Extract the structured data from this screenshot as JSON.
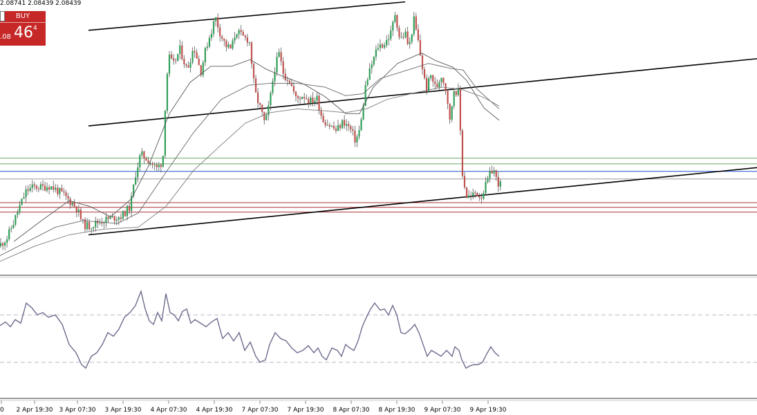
{
  "ohlc_text": "2.08741 2.08439 2.08439",
  "trade_panel": {
    "label": "BUY",
    "price_small": ".08",
    "price_big": "46",
    "price_sup": "4",
    "color": "#c62828"
  },
  "chart_data": [
    {
      "type": "candlestick",
      "x_ticks": [
        "0",
        "2 Apr 19:30",
        "3 Apr 07:30",
        "3 Apr 19:30",
        "4 Apr 07:30",
        "4 Apr 19:30",
        "7 Apr 07:30",
        "7 Apr 19:30",
        "8 Apr 07:30",
        "8 Apr 19:30",
        "9 Apr 07:30",
        "9 Apr 19:30"
      ],
      "y_range": [
        2.0655,
        2.0945
      ],
      "grid": false,
      "price_anchors": [
        [
          0,
          2.0685
        ],
        [
          12,
          2.0694
        ],
        [
          22,
          2.0712
        ],
        [
          30,
          2.0727
        ],
        [
          40,
          2.0744
        ],
        [
          52,
          2.0748
        ],
        [
          62,
          2.0747
        ],
        [
          72,
          2.0749
        ],
        [
          82,
          2.0745
        ],
        [
          92,
          2.074
        ],
        [
          102,
          2.0733
        ],
        [
          112,
          2.0726
        ],
        [
          122,
          2.0708
        ],
        [
          130,
          2.0706
        ],
        [
          145,
          2.0711
        ],
        [
          160,
          2.0714
        ],
        [
          178,
          2.0717
        ],
        [
          190,
          2.0727
        ],
        [
          198,
          2.0763
        ],
        [
          205,
          2.0782
        ],
        [
          215,
          2.0777
        ],
        [
          228,
          2.0767
        ],
        [
          237,
          2.0775
        ],
        [
          240,
          2.0827
        ],
        [
          245,
          2.0886
        ],
        [
          252,
          2.0876
        ],
        [
          262,
          2.0893
        ],
        [
          272,
          2.0871
        ],
        [
          282,
          2.0896
        ],
        [
          292,
          2.0869
        ],
        [
          300,
          2.0896
        ],
        [
          308,
          2.0914
        ],
        [
          313,
          2.0927
        ],
        [
          320,
          2.091
        ],
        [
          328,
          2.0897
        ],
        [
          336,
          2.0893
        ],
        [
          343,
          2.0913
        ],
        [
          352,
          2.0906
        ],
        [
          362,
          2.0903
        ],
        [
          370,
          2.0848
        ],
        [
          378,
          2.0831
        ],
        [
          385,
          2.0813
        ],
        [
          392,
          2.0839
        ],
        [
          398,
          2.087
        ],
        [
          405,
          2.0888
        ],
        [
          412,
          2.0866
        ],
        [
          420,
          2.0861
        ],
        [
          430,
          2.084
        ],
        [
          440,
          2.0845
        ],
        [
          450,
          2.0838
        ],
        [
          460,
          2.0841
        ],
        [
          468,
          2.0819
        ],
        [
          478,
          2.0813
        ],
        [
          488,
          2.0807
        ],
        [
          498,
          2.0817
        ],
        [
          508,
          2.0809
        ],
        [
          516,
          2.0796
        ],
        [
          523,
          2.0811
        ],
        [
          530,
          2.0853
        ],
        [
          538,
          2.0874
        ],
        [
          548,
          2.0896
        ],
        [
          558,
          2.0899
        ],
        [
          567,
          2.091
        ],
        [
          573,
          2.0931
        ],
        [
          580,
          2.0903
        ],
        [
          588,
          2.091
        ],
        [
          593,
          2.0893
        ],
        [
          600,
          2.0925
        ],
        [
          606,
          2.0903
        ],
        [
          611,
          2.088
        ],
        [
          618,
          2.085
        ],
        [
          625,
          2.0866
        ],
        [
          632,
          2.0851
        ],
        [
          640,
          2.0866
        ],
        [
          648,
          2.0847
        ],
        [
          652,
          2.0815
        ],
        [
          658,
          2.0851
        ],
        [
          665,
          2.0847
        ],
        [
          670,
          2.0764
        ],
        [
          676,
          2.0738
        ],
        [
          683,
          2.0737
        ],
        [
          690,
          2.0742
        ],
        [
          697,
          2.0737
        ],
        [
          703,
          2.0747
        ],
        [
          710,
          2.076
        ],
        [
          715,
          2.0768
        ],
        [
          720,
          2.0754
        ],
        [
          725,
          2.075
        ]
      ],
      "moving_averages": [
        {
          "points": [
            [
              20,
              2.069
            ],
            [
              60,
              2.0712
            ],
            [
              100,
              2.0733
            ],
            [
              130,
              2.0727
            ],
            [
              160,
              2.0716
            ],
            [
              190,
              2.0735
            ],
            [
              215,
              2.077
            ],
            [
              245,
              2.0825
            ],
            [
              275,
              2.0858
            ],
            [
              305,
              2.0875
            ],
            [
              335,
              2.0875
            ],
            [
              362,
              2.0882
            ],
            [
              385,
              2.0872
            ],
            [
              410,
              2.0864
            ],
            [
              440,
              2.0856
            ],
            [
              470,
              2.0843
            ],
            [
              500,
              2.0825
            ],
            [
              520,
              2.0825
            ],
            [
              540,
              2.0853
            ],
            [
              575,
              2.0878
            ],
            [
              610,
              2.0889
            ],
            [
              630,
              2.0881
            ],
            [
              655,
              2.0874
            ],
            [
              675,
              2.086
            ],
            [
              700,
              2.0831
            ],
            [
              722,
              2.0818
            ]
          ],
          "color": "#555555"
        },
        {
          "points": [
            [
              0,
              2.0675
            ],
            [
              40,
              2.069
            ],
            [
              80,
              2.0705
            ],
            [
              120,
              2.0712
            ],
            [
              170,
              2.0709
            ],
            [
              200,
              2.072
            ],
            [
              240,
              2.0763
            ],
            [
              280,
              2.0805
            ],
            [
              320,
              2.084
            ],
            [
              360,
              2.0855
            ],
            [
              390,
              2.0857
            ],
            [
              430,
              2.0857
            ],
            [
              470,
              2.0853
            ],
            [
              500,
              2.0844
            ],
            [
              525,
              2.0846
            ],
            [
              550,
              2.0862
            ],
            [
              585,
              2.087
            ],
            [
              620,
              2.0878
            ],
            [
              650,
              2.0873
            ],
            [
              670,
              2.0871
            ],
            [
              690,
              2.0851
            ],
            [
              722,
              2.083
            ]
          ],
          "color": "#666666"
        },
        {
          "points": [
            [
              0,
              2.0669
            ],
            [
              50,
              2.0685
            ],
            [
              100,
              2.0697
            ],
            [
              150,
              2.0703
            ],
            [
              200,
              2.0705
            ],
            [
              240,
              2.0727
            ],
            [
              280,
              2.0765
            ],
            [
              320,
              2.0792
            ],
            [
              355,
              2.0815
            ],
            [
              390,
              2.0826
            ],
            [
              430,
              2.083
            ],
            [
              470,
              2.0828
            ],
            [
              500,
              2.0826
            ],
            [
              530,
              2.083
            ],
            [
              560,
              2.084
            ],
            [
              600,
              2.0847
            ],
            [
              640,
              2.0853
            ],
            [
              670,
              2.085
            ],
            [
              700,
              2.0842
            ],
            [
              722,
              2.0833
            ]
          ],
          "color": "#777777"
        }
      ],
      "trendlines": [
        {
          "from": [
            128,
            2.0913
          ],
          "to": [
            586,
            2.0943
          ],
          "color": "#000000"
        },
        {
          "from": [
            128,
            2.0812
          ],
          "to": [
            1095,
            2.0883
          ],
          "color": "#000000"
        },
        {
          "from": [
            128,
            2.0697
          ],
          "to": [
            1095,
            2.0768
          ],
          "color": "#000000"
        }
      ],
      "horizontal_levels": [
        {
          "price": 2.0778,
          "color": "#66aa66"
        },
        {
          "price": 2.0772,
          "color": "#66aa66"
        },
        {
          "price": 2.0764,
          "color": "#2255cc"
        },
        {
          "price": 2.0756,
          "color": "#999999"
        },
        {
          "price": 2.0731,
          "color": "#aa3333"
        },
        {
          "price": 2.0726,
          "color": "#aa3333"
        },
        {
          "price": 2.0721,
          "color": "#aa3333"
        }
      ],
      "colors": {
        "bull": "#2e9e56",
        "bear": "#c0504d",
        "wick": "#555555"
      }
    },
    {
      "type": "line",
      "y_range": [
        0,
        100
      ],
      "reference_levels": [
        70,
        30
      ],
      "color": "#6b6b8e",
      "points": [
        [
          0,
          61
        ],
        [
          8,
          64
        ],
        [
          15,
          60
        ],
        [
          22,
          66
        ],
        [
          30,
          63
        ],
        [
          38,
          80
        ],
        [
          46,
          76
        ],
        [
          54,
          70
        ],
        [
          62,
          72
        ],
        [
          70,
          68
        ],
        [
          80,
          70
        ],
        [
          90,
          62
        ],
        [
          100,
          45
        ],
        [
          110,
          38
        ],
        [
          118,
          28
        ],
        [
          124,
          25
        ],
        [
          132,
          35
        ],
        [
          140,
          38
        ],
        [
          148,
          45
        ],
        [
          156,
          55
        ],
        [
          164,
          52
        ],
        [
          172,
          58
        ],
        [
          180,
          68
        ],
        [
          188,
          72
        ],
        [
          196,
          78
        ],
        [
          204,
          90
        ],
        [
          210,
          75
        ],
        [
          216,
          65
        ],
        [
          222,
          62
        ],
        [
          228,
          72
        ],
        [
          234,
          65
        ],
        [
          240,
          88
        ],
        [
          246,
          72
        ],
        [
          252,
          70
        ],
        [
          258,
          65
        ],
        [
          264,
          73
        ],
        [
          270,
          75
        ],
        [
          276,
          63
        ],
        [
          282,
          66
        ],
        [
          290,
          63
        ],
        [
          298,
          60
        ],
        [
          306,
          64
        ],
        [
          314,
          67
        ],
        [
          322,
          50
        ],
        [
          330,
          55
        ],
        [
          338,
          48
        ],
        [
          346,
          55
        ],
        [
          354,
          40
        ],
        [
          362,
          47
        ],
        [
          370,
          35
        ],
        [
          376,
          30
        ],
        [
          384,
          32
        ],
        [
          390,
          45
        ],
        [
          398,
          55
        ],
        [
          406,
          50
        ],
        [
          414,
          48
        ],
        [
          422,
          42
        ],
        [
          430,
          38
        ],
        [
          438,
          40
        ],
        [
          446,
          44
        ],
        [
          454,
          38
        ],
        [
          460,
          42
        ],
        [
          466,
          35
        ],
        [
          472,
          32
        ],
        [
          480,
          42
        ],
        [
          488,
          40
        ],
        [
          494,
          35
        ],
        [
          500,
          45
        ],
        [
          506,
          42
        ],
        [
          512,
          40
        ],
        [
          518,
          48
        ],
        [
          524,
          60
        ],
        [
          530,
          68
        ],
        [
          536,
          75
        ],
        [
          542,
          80
        ],
        [
          550,
          74
        ],
        [
          556,
          75
        ],
        [
          562,
          70
        ],
        [
          568,
          78
        ],
        [
          574,
          70
        ],
        [
          580,
          55
        ],
        [
          586,
          54
        ],
        [
          594,
          58
        ],
        [
          600,
          62
        ],
        [
          606,
          55
        ],
        [
          612,
          45
        ],
        [
          618,
          35
        ],
        [
          624,
          40
        ],
        [
          630,
          38
        ],
        [
          638,
          35
        ],
        [
          646,
          40
        ],
        [
          654,
          35
        ],
        [
          658,
          43
        ],
        [
          664,
          40
        ],
        [
          668,
          32
        ],
        [
          674,
          25
        ],
        [
          680,
          27
        ],
        [
          686,
          28
        ],
        [
          692,
          28
        ],
        [
          698,
          30
        ],
        [
          704,
          37
        ],
        [
          710,
          43
        ],
        [
          716,
          38
        ],
        [
          722,
          35
        ]
      ]
    }
  ]
}
